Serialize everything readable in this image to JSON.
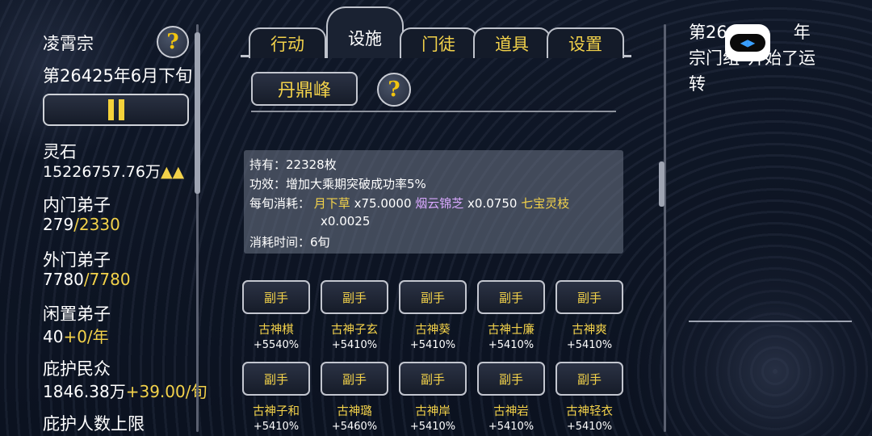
{
  "sidebar": {
    "sect_name": "凌霄宗",
    "date": "第26425年6月下旬",
    "stats": [
      {
        "label": "灵石",
        "value": "15226757.76万",
        "suffix": "▲▲"
      },
      {
        "label": "内门弟子",
        "value": "279",
        "suffix": "/2330"
      },
      {
        "label": "外门弟子",
        "value": "7780",
        "suffix": "/7780"
      },
      {
        "label": "闲置弟子",
        "value": "40",
        "suffix": "+0/年"
      },
      {
        "label": "庇护民众",
        "value": "1846.38万",
        "suffix": "+39.00/旬"
      },
      {
        "label": "庇护人数上限",
        "value": "",
        "suffix": ""
      }
    ]
  },
  "tabs": [
    "行动",
    "设施",
    "门徒",
    "道具",
    "设置"
  ],
  "active_tab": "设施",
  "facility": {
    "name": "丹鼎峰"
  },
  "info": {
    "holding": "持有：22328枚",
    "effect": "功效：增加大乘期突破成功率5%",
    "cost_label": "每旬消耗：",
    "herb1": "月下草",
    "herb1_amt": " x75.0000 ",
    "herb2": "烟云锦芝",
    "herb2_amt": " x0.0750 ",
    "herb3": "七宝灵枝",
    "herb3_amt": "x0.0025",
    "duration": "消耗时间：6旬"
  },
  "assistants": [
    {
      "button": "副手",
      "name": "古神棋",
      "bonus": "+5540%"
    },
    {
      "button": "副手",
      "name": "古神子玄",
      "bonus": "+5410%"
    },
    {
      "button": "副手",
      "name": "古神葵",
      "bonus": "+5410%"
    },
    {
      "button": "副手",
      "name": "古神士廉",
      "bonus": "+5410%"
    },
    {
      "button": "副手",
      "name": "古神爽",
      "bonus": "+5410%"
    },
    {
      "button": "副手",
      "name": "古神子和",
      "bonus": "+5410%"
    },
    {
      "button": "副手",
      "name": "古神璐",
      "bonus": "+5460%"
    },
    {
      "button": "副手",
      "name": "古神岸",
      "bonus": "+5410%"
    },
    {
      "button": "副手",
      "name": "古神岩",
      "bonus": "+5410%"
    },
    {
      "button": "副手",
      "name": "古神轻衣",
      "bonus": "+5410%"
    }
  ],
  "log": {
    "line1": "第26",
    "line1_end": "年",
    "line2a": "宗门组",
    "line2b": "开始了运",
    "line3": "转"
  },
  "colors": {
    "accent": "#f3d24a",
    "rare": "#d9a8ff",
    "background": "#0d1320"
  }
}
